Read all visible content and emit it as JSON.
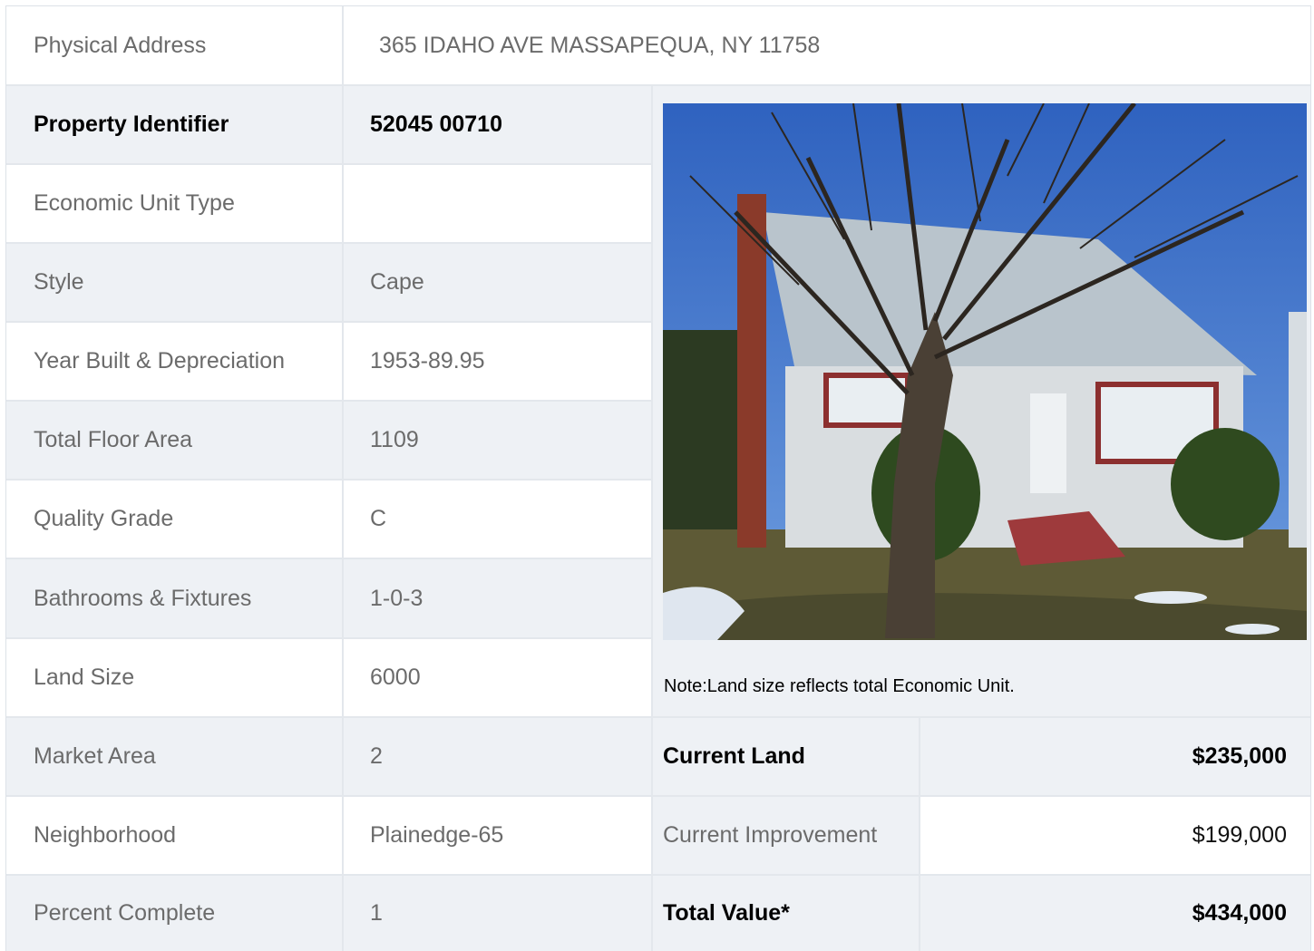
{
  "address": {
    "label": "Physical Address",
    "value": "365  IDAHO AVE  MASSAPEQUA, NY  11758"
  },
  "property_id": {
    "label": "Property Identifier",
    "value": "52045  00710"
  },
  "details": [
    {
      "label": "Economic Unit Type",
      "value": ""
    },
    {
      "label": "Style",
      "value": "Cape"
    },
    {
      "label": "Year Built & Depreciation",
      "value": "1953-89.95"
    },
    {
      "label": "Total Floor Area",
      "value": "1109"
    },
    {
      "label": "Quality Grade",
      "value": "C"
    },
    {
      "label": "Bathrooms & Fixtures",
      "value": "1-0-3"
    },
    {
      "label": "Land Size",
      "value": "6000"
    },
    {
      "label": "Market Area",
      "value": "2"
    },
    {
      "label": "Neighborhood",
      "value": "Plainedge-65"
    },
    {
      "label": "Percent Complete",
      "value": "1"
    }
  ],
  "note": "Note:Land size reflects total Economic Unit.",
  "valuation": [
    {
      "label": "Current Land",
      "value": "$235,000"
    },
    {
      "label": "Current Improvement",
      "value": "$199,000"
    },
    {
      "label": "Total Value*",
      "value": "$434,000"
    }
  ],
  "colors": {
    "shade": "#eef1f5",
    "border": "#e3e7ec",
    "label_text": "#6b6b6b",
    "bold_text": "#000000"
  }
}
